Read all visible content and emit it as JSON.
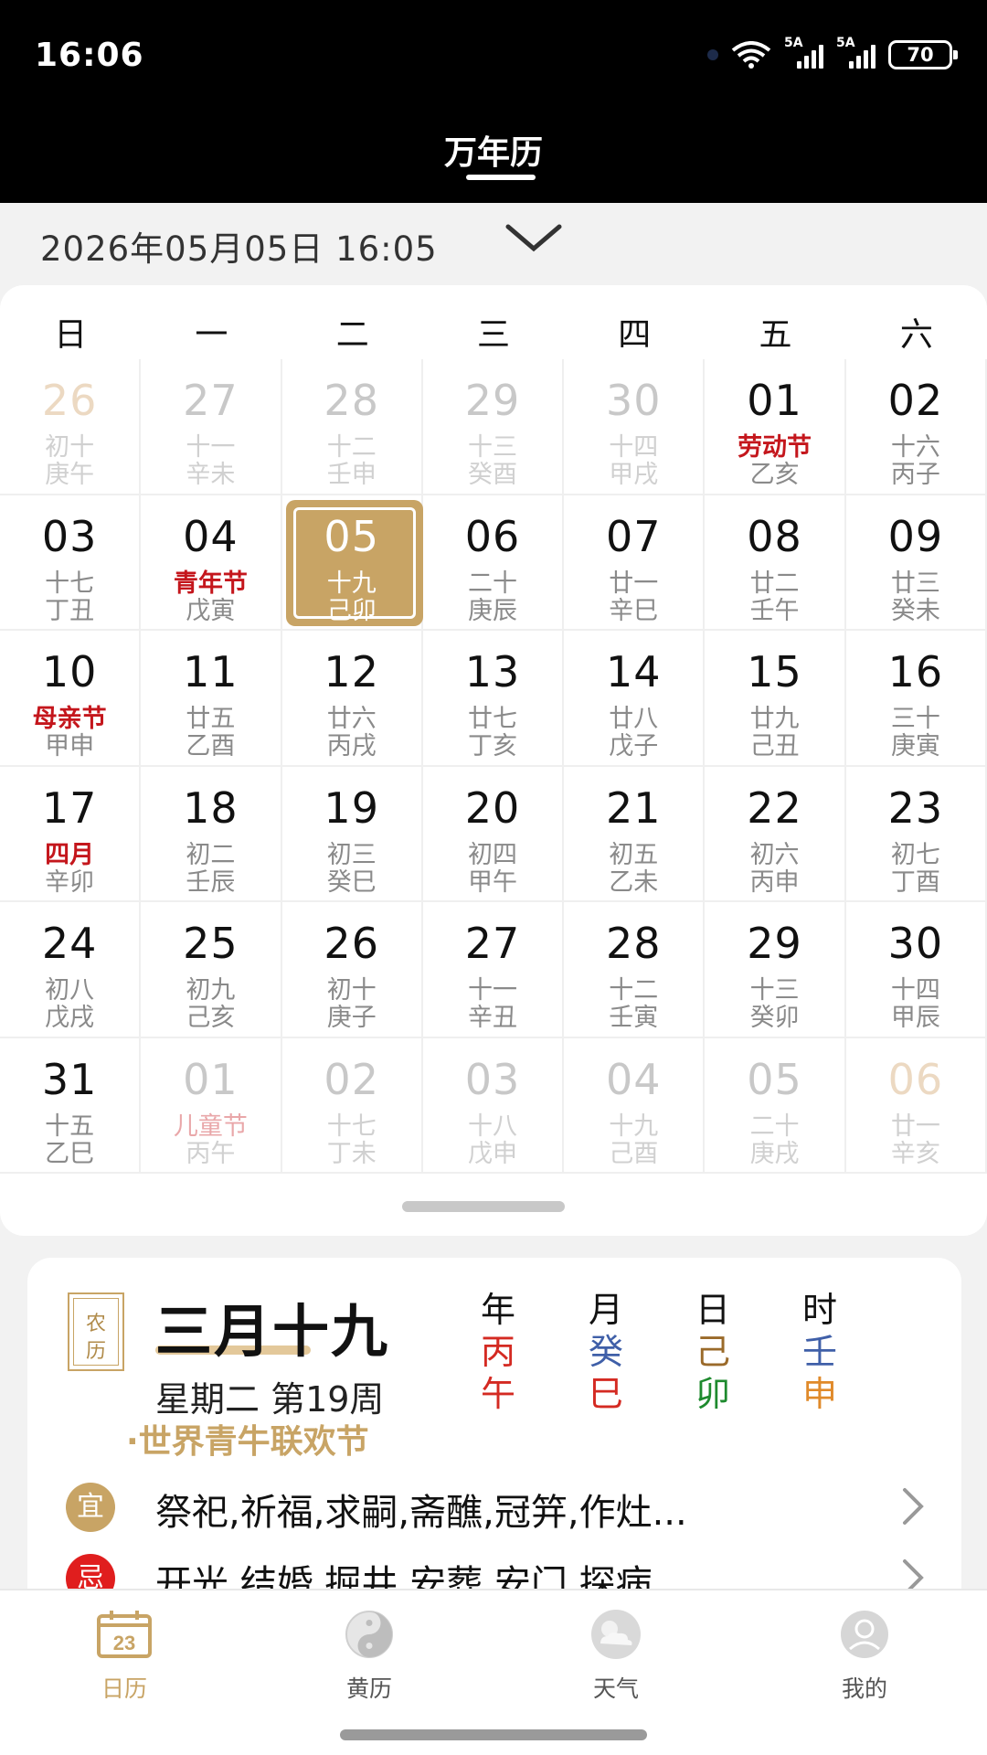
{
  "status_bar": {
    "time": "16:06",
    "signal1": "5A",
    "signal2": "5A",
    "battery": "70"
  },
  "header": {
    "title": "万年历"
  },
  "date_bar": {
    "value": "2026年05月05日 16:05"
  },
  "calendar": {
    "weekdays": [
      "日",
      "一",
      "二",
      "三",
      "四",
      "五",
      "六"
    ],
    "days": [
      {
        "day": "26",
        "l1": "初十",
        "l2": "庚午",
        "state": "faded weekend"
      },
      {
        "day": "27",
        "l1": "十一",
        "l2": "辛未",
        "state": "faded"
      },
      {
        "day": "28",
        "l1": "十二",
        "l2": "壬申",
        "state": "faded"
      },
      {
        "day": "29",
        "l1": "十三",
        "l2": "癸酉",
        "state": "faded"
      },
      {
        "day": "30",
        "l1": "十四",
        "l2": "甲戌",
        "state": "faded"
      },
      {
        "day": "01",
        "l1": "劳动节",
        "l2": "乙亥",
        "state": "",
        "red": true
      },
      {
        "day": "02",
        "l1": "十六",
        "l2": "丙子",
        "state": ""
      },
      {
        "day": "03",
        "l1": "十七",
        "l2": "丁丑",
        "state": ""
      },
      {
        "day": "04",
        "l1": "青年节",
        "l2": "戊寅",
        "state": "",
        "red": true
      },
      {
        "day": "05",
        "l1": "十九",
        "l2": "己卯",
        "state": "selected"
      },
      {
        "day": "06",
        "l1": "二十",
        "l2": "庚辰",
        "state": ""
      },
      {
        "day": "07",
        "l1": "廿一",
        "l2": "辛巳",
        "state": ""
      },
      {
        "day": "08",
        "l1": "廿二",
        "l2": "壬午",
        "state": ""
      },
      {
        "day": "09",
        "l1": "廿三",
        "l2": "癸未",
        "state": ""
      },
      {
        "day": "10",
        "l1": "母亲节",
        "l2": "甲申",
        "state": "",
        "red": true
      },
      {
        "day": "11",
        "l1": "廿五",
        "l2": "乙酉",
        "state": ""
      },
      {
        "day": "12",
        "l1": "廿六",
        "l2": "丙戌",
        "state": ""
      },
      {
        "day": "13",
        "l1": "廿七",
        "l2": "丁亥",
        "state": ""
      },
      {
        "day": "14",
        "l1": "廿八",
        "l2": "戊子",
        "state": ""
      },
      {
        "day": "15",
        "l1": "廿九",
        "l2": "己丑",
        "state": ""
      },
      {
        "day": "16",
        "l1": "三十",
        "l2": "庚寅",
        "state": ""
      },
      {
        "day": "17",
        "l1": "四月",
        "l2": "辛卯",
        "state": "",
        "red": true
      },
      {
        "day": "18",
        "l1": "初二",
        "l2": "壬辰",
        "state": ""
      },
      {
        "day": "19",
        "l1": "初三",
        "l2": "癸巳",
        "state": ""
      },
      {
        "day": "20",
        "l1": "初四",
        "l2": "甲午",
        "state": ""
      },
      {
        "day": "21",
        "l1": "初五",
        "l2": "乙未",
        "state": ""
      },
      {
        "day": "22",
        "l1": "初六",
        "l2": "丙申",
        "state": ""
      },
      {
        "day": "23",
        "l1": "初七",
        "l2": "丁酉",
        "state": ""
      },
      {
        "day": "24",
        "l1": "初八",
        "l2": "戊戌",
        "state": ""
      },
      {
        "day": "25",
        "l1": "初九",
        "l2": "己亥",
        "state": ""
      },
      {
        "day": "26",
        "l1": "初十",
        "l2": "庚子",
        "state": ""
      },
      {
        "day": "27",
        "l1": "十一",
        "l2": "辛丑",
        "state": ""
      },
      {
        "day": "28",
        "l1": "十二",
        "l2": "壬寅",
        "state": ""
      },
      {
        "day": "29",
        "l1": "十三",
        "l2": "癸卯",
        "state": ""
      },
      {
        "day": "30",
        "l1": "十四",
        "l2": "甲辰",
        "state": ""
      },
      {
        "day": "31",
        "l1": "十五",
        "l2": "乙巳",
        "state": ""
      },
      {
        "day": "01",
        "l1": "儿童节",
        "l2": "丙午",
        "state": "faded",
        "red": true
      },
      {
        "day": "02",
        "l1": "十七",
        "l2": "丁未",
        "state": "faded"
      },
      {
        "day": "03",
        "l1": "十八",
        "l2": "戊申",
        "state": "faded"
      },
      {
        "day": "04",
        "l1": "十九",
        "l2": "己酉",
        "state": "faded"
      },
      {
        "day": "05",
        "l1": "二十",
        "l2": "庚戌",
        "state": "faded"
      },
      {
        "day": "06",
        "l1": "廿一",
        "l2": "辛亥",
        "state": "faded weekend"
      }
    ]
  },
  "almanac": {
    "badge": [
      "农",
      "历"
    ],
    "lunar_date": "三月十九",
    "week_line": "星期二 第19周",
    "festival": "·世界青牛联欢节",
    "ganzhi": [
      {
        "head": "年",
        "top": "丙",
        "bottom": "午",
        "color_top": "#d42a22",
        "color_bottom": "#d42a22"
      },
      {
        "head": "月",
        "top": "癸",
        "bottom": "巳",
        "color_top": "#3f5fa8",
        "color_bottom": "#d42a22"
      },
      {
        "head": "日",
        "top": "己",
        "bottom": "卯",
        "color_top": "#9a6a2a",
        "color_bottom": "#1e8a2e"
      },
      {
        "head": "时",
        "top": "壬",
        "bottom": "申",
        "color_top": "#3f5fa8",
        "color_bottom": "#e08a2a"
      }
    ],
    "yi_label": "宜",
    "yi_text": "祭祀,祈福,求嗣,斋醮,冠笄,作灶...",
    "ji_label": "忌",
    "ji_text": "开光,结婚,掘井,安葬,安门,探病",
    "colors": {
      "yi": "#c8a465",
      "ji": "#e01e1e",
      "accent": "#c8a465"
    }
  },
  "nav": {
    "items": [
      {
        "label": "日历",
        "icon": "calendar-icon",
        "badge": "23"
      },
      {
        "label": "黄历",
        "icon": "yinyang-icon"
      },
      {
        "label": "天气",
        "icon": "weather-icon"
      },
      {
        "label": "我的",
        "icon": "profile-icon"
      }
    ]
  }
}
